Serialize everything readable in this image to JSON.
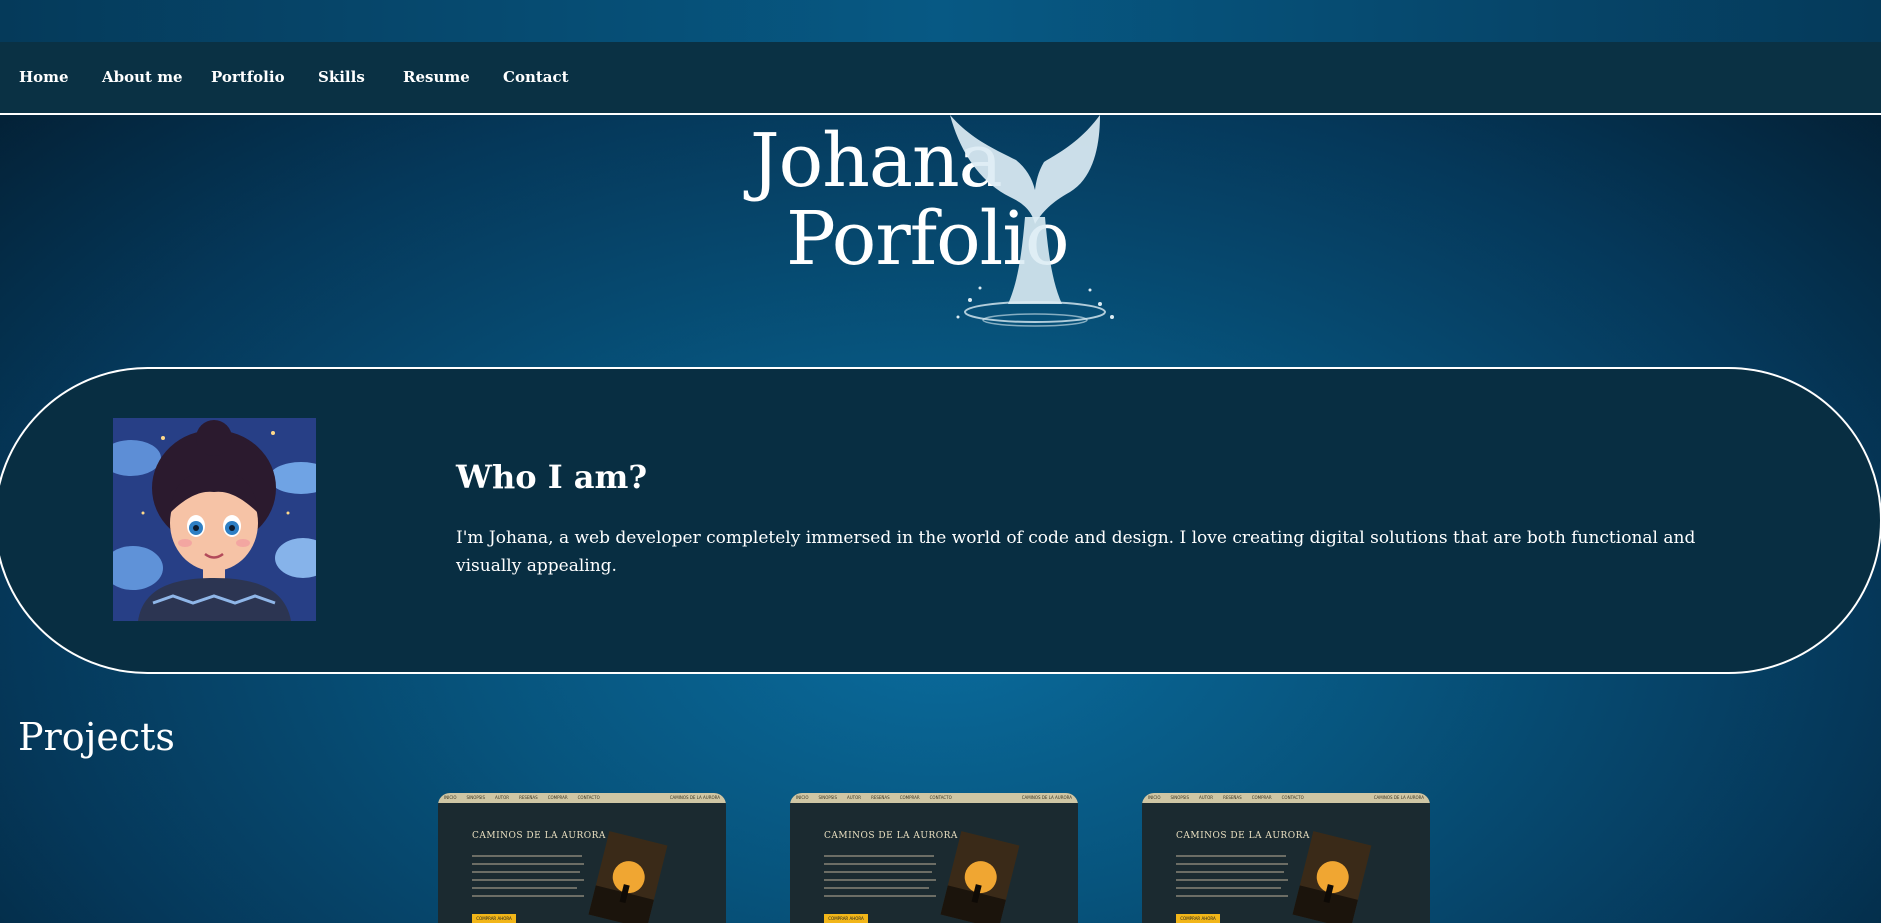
{
  "nav": {
    "items": [
      {
        "label": "Home"
      },
      {
        "label": "About me"
      },
      {
        "label": "Portfolio"
      },
      {
        "label": "Skills"
      },
      {
        "label": "Resume"
      },
      {
        "label": "Contact"
      }
    ]
  },
  "hero": {
    "title_line1": "Johana",
    "title_line2": "Porfolio"
  },
  "about": {
    "heading": "Who I am?",
    "text": "I'm Johana, a web developer completely immersed in the world of code and design. I love creating digital solutions that are both functional and visually appealing."
  },
  "projects": {
    "title": "Projects",
    "cards": [
      {
        "site_title": "CAMINOS DE LA AURORA",
        "nav_links": [
          "INICIO",
          "SINOPSIS",
          "AUTOR",
          "RESEÑAS",
          "COMPRAR",
          "CONTACTO"
        ],
        "brand": "CAMINOS DE LA AURORA",
        "button": "COMPRAR AHORA"
      },
      {
        "site_title": "CAMINOS DE LA AURORA",
        "nav_links": [
          "INICIO",
          "SINOPSIS",
          "AUTOR",
          "RESEÑAS",
          "COMPRAR",
          "CONTACTO"
        ],
        "brand": "CAMINOS DE LA AURORA",
        "button": "COMPRAR AHORA"
      },
      {
        "site_title": "CAMINOS DE LA AURORA",
        "nav_links": [
          "INICIO",
          "SINOPSIS",
          "AUTOR",
          "RESEÑAS",
          "COMPRAR",
          "CONTACTO"
        ],
        "brand": "CAMINOS DE LA AURORA",
        "button": "COMPRAR AHORA"
      }
    ]
  },
  "colors": {
    "nav_bg": "#0a3144",
    "about_bg": "#082e42",
    "accent_button": "#f2b619"
  },
  "icons": [
    "whale-tail-icon",
    "avatar-illustration"
  ]
}
